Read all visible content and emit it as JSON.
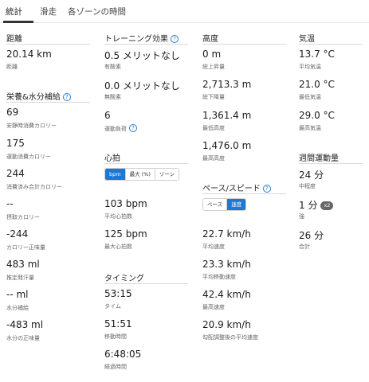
{
  "tabs": [
    "統計",
    "滑走",
    "各ゾーンの時間"
  ],
  "distance": {
    "title": "距離",
    "value": "20.14 km",
    "label": "距離"
  },
  "nutrition": {
    "title": "栄養&水分補給",
    "items": [
      {
        "value": "69",
        "label": "安静時消費カロリー"
      },
      {
        "value": "175",
        "label": "運動消費カロリー"
      },
      {
        "value": "244",
        "label": "消費済み合計カロリー"
      },
      {
        "value": "--",
        "label": "摂取カロリー"
      },
      {
        "value": "-244",
        "label": "カロリー正味量"
      },
      {
        "value": "483 ml",
        "label": "推定発汗量"
      },
      {
        "value": "-- ml",
        "label": "水分補給"
      },
      {
        "value": "-483 ml",
        "label": "水分の正味量"
      }
    ]
  },
  "training": {
    "title": "トレーニング効果",
    "items": [
      {
        "value": "0.5 メリットなし",
        "label": "有酸素"
      },
      {
        "value": "0.0 メリットなし",
        "label": "無酸素"
      },
      {
        "value": "6",
        "label": "運動負荷"
      }
    ]
  },
  "heart_rate": {
    "title": "心拍",
    "toggle": [
      "bpm",
      "最大 (%)",
      "ゾーン"
    ],
    "items": [
      {
        "value": "103 bpm",
        "label": "平均心拍数"
      },
      {
        "value": "125 bpm",
        "label": "最大心拍数"
      }
    ]
  },
  "timing": {
    "title": "タイミング",
    "items": [
      {
        "value": "53:15",
        "label": "タイム"
      },
      {
        "value": "51:51",
        "label": "移動時間"
      },
      {
        "value": "6:48:05",
        "label": "経過時間"
      }
    ]
  },
  "elevation": {
    "title": "高度",
    "items": [
      {
        "value": "0 m",
        "label": "総上昇量"
      },
      {
        "value": "2,713.3 m",
        "label": "総下降量"
      },
      {
        "value": "1,361.4 m",
        "label": "最低高度"
      },
      {
        "value": "1,476.0 m",
        "label": "最高高度"
      }
    ]
  },
  "pace_speed": {
    "title": "ペース/スピード",
    "toggle": [
      "ペース",
      "速度"
    ],
    "items": [
      {
        "value": "22.7 km/h",
        "label": "平均速度"
      },
      {
        "value": "23.3 km/h",
        "label": "平均移動速度"
      },
      {
        "value": "42.4 km/h",
        "label": "最高速度"
      },
      {
        "value": "20.9 km/h",
        "label": "勾配調整後の平均速度"
      }
    ]
  },
  "temperature": {
    "title": "気温",
    "items": [
      {
        "value": "13.7 °C",
        "label": "平均気温"
      },
      {
        "value": "21.0 °C",
        "label": "最低気温"
      },
      {
        "value": "29.0 °C",
        "label": "最高気温"
      }
    ]
  },
  "intensity": {
    "title": "週間運動量",
    "items": [
      {
        "value": "24 分",
        "label": "中程度"
      },
      {
        "value": "1 分",
        "label": "強",
        "badge": "x2"
      },
      {
        "value": "26 分",
        "label": "合計"
      }
    ]
  },
  "colors": {
    "accent": "#1c78d4",
    "help": "#2b7ad0",
    "badge": "#666666"
  },
  "icons": {
    "help": "question-circle-icon"
  }
}
